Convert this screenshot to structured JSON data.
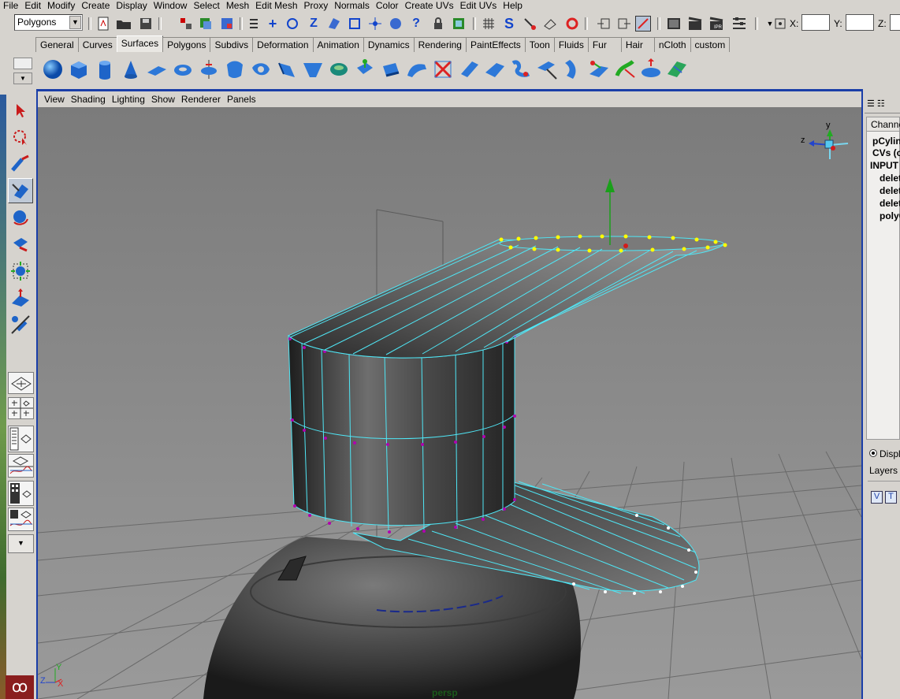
{
  "menubar": {
    "items": [
      "File",
      "Edit",
      "Modify",
      "Create",
      "Display",
      "Window",
      "Select",
      "Mesh",
      "Edit Mesh",
      "Proxy",
      "Normals",
      "Color",
      "Create UVs",
      "Edit UVs",
      "Help"
    ]
  },
  "statusline": {
    "mode": "Polygons",
    "x_label": "X:",
    "y_label": "Y:",
    "z_label": "Z:"
  },
  "shelf": {
    "tabs": [
      "General",
      "Curves",
      "Surfaces",
      "Polygons",
      "Subdivs",
      "Deformation",
      "Animation",
      "Dynamics",
      "Rendering",
      "PaintEffects",
      "Toon",
      "Fluids",
      "Fur",
      "Hair",
      "nCloth",
      "custom"
    ],
    "active_tab": "Surfaces",
    "tools": [
      "nurbs-sphere",
      "nurbs-cube",
      "nurbs-cylinder",
      "nurbs-cone",
      "nurbs-plane",
      "nurbs-torus",
      "revolve",
      "loft",
      "planar",
      "extrude",
      "birail",
      "boundary",
      "square",
      "bevel",
      "bevel-plus",
      "intersect",
      "project-curve",
      "trim",
      "untrim",
      "attach",
      "detach",
      "align",
      "open-close",
      "insert-isoparm",
      "extend",
      "offset",
      "rebuild",
      "reverse",
      "sculpt"
    ]
  },
  "panel": {
    "menu": [
      "View",
      "Shading",
      "Lighting",
      "Show",
      "Renderer",
      "Panels"
    ],
    "camera_label": "persp",
    "axis_y": "y",
    "axis_z": "z",
    "origin_y": "Y",
    "origin_z": "Z",
    "origin_x": "X"
  },
  "channel_box": {
    "tab_label": "Channel",
    "object": "pCylind",
    "cvs": "CVs (c",
    "inputs": "INPUT",
    "input_items": [
      "delet",
      "delet",
      "delet",
      "polyC"
    ],
    "display_label": "Displ",
    "layers_label": "Layers",
    "v_label": "V",
    "t_label": "T"
  },
  "colors": {
    "viewport_bg": "#808080",
    "selection_border": "#1a3ea8",
    "wire": "#4fe6f5",
    "cv_point": "#b000b0",
    "selected_cv": "#ffff00"
  }
}
